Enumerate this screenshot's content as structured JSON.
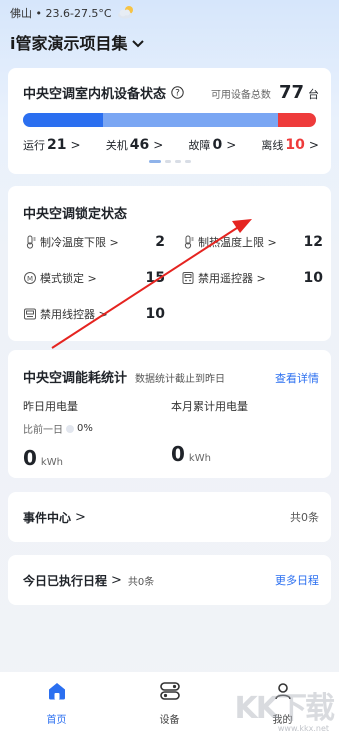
{
  "header": {
    "location": "佛山 • 23.6-27.5°C",
    "project": "i管家演示项目集"
  },
  "ac_status": {
    "title": "中央空调室内机设备状态",
    "total_label": "可用设备总数",
    "total_value": "77",
    "total_unit": "台",
    "colors": {
      "running": "#2b6ff0",
      "off": "#7aa6f3",
      "fault": "#f2c94c",
      "offline": "#ee3b3b"
    },
    "stats": [
      {
        "label": "运行",
        "value": "21",
        "arrow": ">"
      },
      {
        "label": "关机",
        "value": "46",
        "arrow": ">"
      },
      {
        "label": "故障",
        "value": "0",
        "arrow": ">"
      },
      {
        "label": "离线",
        "value": "10",
        "arrow": ">"
      }
    ]
  },
  "lock_status": {
    "title": "中央空调锁定状态",
    "items": [
      {
        "icon": "thermometer-icon",
        "label": "制冷温度下限",
        "arrow": ">",
        "value": "2"
      },
      {
        "icon": "thermometer-icon",
        "label": "制热温度上限",
        "arrow": ">",
        "value": "12"
      },
      {
        "icon": "mode-icon",
        "label": "模式锁定",
        "arrow": ">",
        "value": "15"
      },
      {
        "icon": "remote-icon",
        "label": "禁用遥控器",
        "arrow": ">",
        "value": "10"
      },
      {
        "icon": "wired-controller-icon",
        "label": "禁用线控器",
        "arrow": ">",
        "value": "10"
      }
    ]
  },
  "energy": {
    "title": "中央空调能耗统计",
    "subtitle": "数据统计截止到昨日",
    "link": "查看详情",
    "yesterday": {
      "label": "昨日用电量",
      "compare_label": "比前一日",
      "compare_value": "0%",
      "value": "0",
      "unit": "kWh"
    },
    "month": {
      "label": "本月累计用电量",
      "value": "0",
      "unit": "kWh"
    }
  },
  "events": {
    "title": "事件中心",
    "arrow": ">",
    "count": "共0条"
  },
  "schedule": {
    "title": "今日已执行日程",
    "arrow": ">",
    "count": "共0条",
    "link": "更多日程"
  },
  "tabs": [
    {
      "label": "首页",
      "icon": "home-icon",
      "active": true
    },
    {
      "label": "设备",
      "icon": "device-icon",
      "active": false
    },
    {
      "label": "我的",
      "icon": "profile-icon",
      "active": false
    }
  ],
  "watermark": {
    "text": "KK下载",
    "url": "www.kkx.net"
  }
}
